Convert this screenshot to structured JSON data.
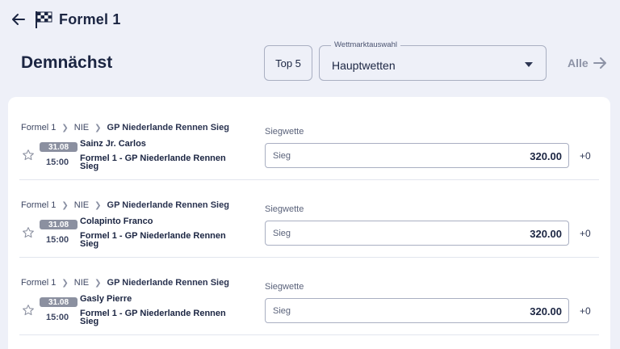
{
  "header": {
    "title": "Formel 1",
    "back_icon": "arrow-left-icon",
    "sport_icon": "checkered-flag-icon"
  },
  "section": {
    "title": "Demnächst",
    "top5_label": "Top 5",
    "select_legend": "Wettmarktauswahl",
    "select_value": "Hauptwetten",
    "all_label": "Alle"
  },
  "events": [
    {
      "crumb_sport": "Formel 1",
      "crumb_country": "NIE",
      "crumb_event": "GP Niederlande Rennen Sieg",
      "date": "31.08",
      "time": "15:00",
      "driver": "Sainz Jr. Carlos",
      "market": "Formel 1 - GP Niederlande Rennen Sieg",
      "bet_type": "Siegwette",
      "outcome": "Sieg",
      "odds": "320.00",
      "more": "+0"
    },
    {
      "crumb_sport": "Formel 1",
      "crumb_country": "NIE",
      "crumb_event": "GP Niederlande Rennen Sieg",
      "date": "31.08",
      "time": "15:00",
      "driver": "Colapinto Franco",
      "market": "Formel 1 - GP Niederlande Rennen Sieg",
      "bet_type": "Siegwette",
      "outcome": "Sieg",
      "odds": "320.00",
      "more": "+0"
    },
    {
      "crumb_sport": "Formel 1",
      "crumb_country": "NIE",
      "crumb_event": "GP Niederlande Rennen Sieg",
      "date": "31.08",
      "time": "15:00",
      "driver": "Gasly Pierre",
      "market": "Formel 1 - GP Niederlande Rennen Sieg",
      "bet_type": "Siegwette",
      "outcome": "Sieg",
      "odds": "320.00",
      "more": "+0"
    }
  ],
  "colors": {
    "background": "#eef0f8",
    "text": "#1b2542",
    "date_badge": "#8b90a0",
    "link_muted": "#8d93a6"
  }
}
